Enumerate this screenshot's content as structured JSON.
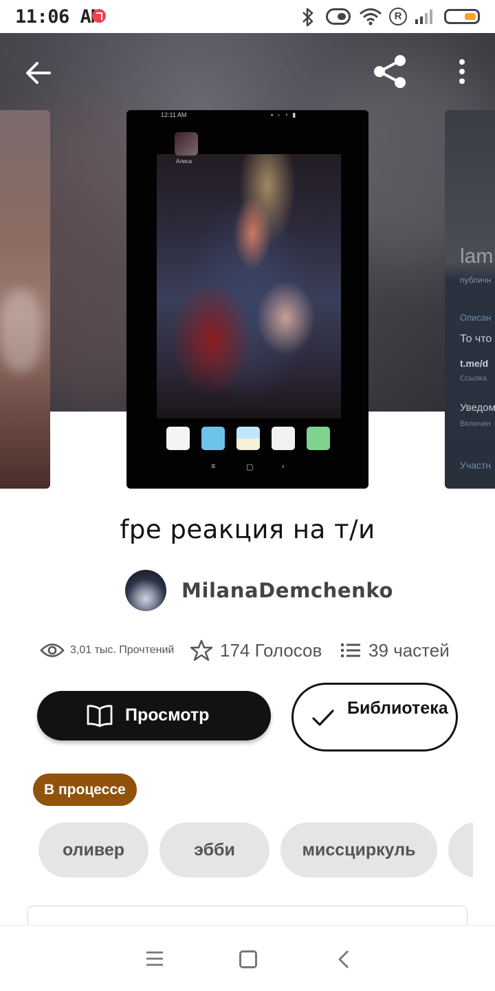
{
  "status_bar": {
    "time": "11:06 AM",
    "icons": [
      "music-icon",
      "bluetooth-icon",
      "vibrate-icon",
      "wifi-icon",
      "roaming-icon",
      "signal-icon",
      "battery-icon"
    ],
    "roaming_letter": "R",
    "battery_color": "#f5a623",
    "music_color": "#f0424f"
  },
  "toolbar": {
    "icons": [
      "back-arrow-icon",
      "share-icon",
      "more-vertical-icon"
    ]
  },
  "cover_main": {
    "mini_time": "12:11 AM",
    "mini_app_label": "Алиса"
  },
  "cover_right": {
    "lines": [
      "lam",
      "публичн",
      "Описан",
      "То что",
      "t.me/d",
      "Ссылка",
      "Уведом",
      "Включен",
      "Участн"
    ]
  },
  "story": {
    "title": "fpe реакция на т/и",
    "author": "MilanaDemchenko",
    "reads": "3,01 тыс. Прочтений",
    "votes": "174 Голосов",
    "parts": "39 частей",
    "read_button": "Просмотр",
    "library_button": "Библиотека",
    "status": "В процессе",
    "status_color": "#91520c",
    "tags": [
      "оливер",
      "эбби",
      "миссциркуль"
    ]
  },
  "nav_bar": {
    "icons": [
      "menu-icon",
      "home-icon",
      "back-icon"
    ]
  }
}
